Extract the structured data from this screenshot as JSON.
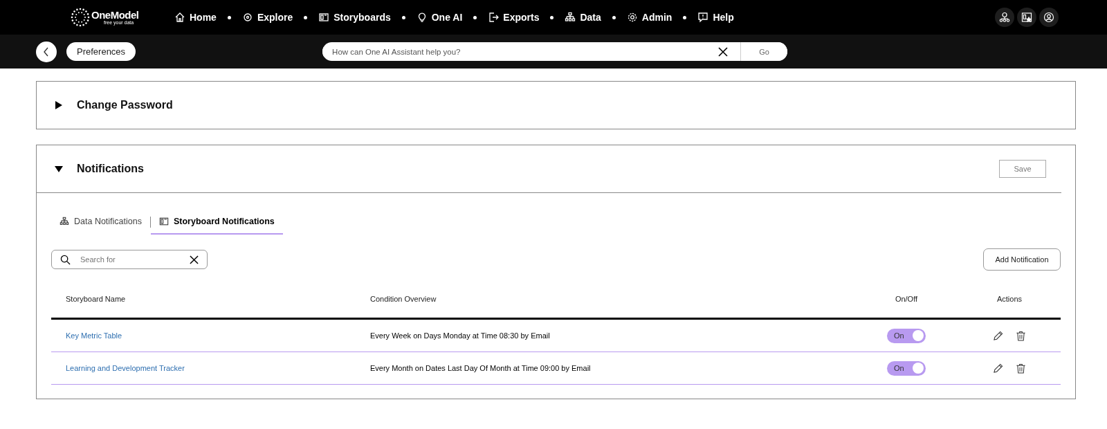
{
  "logo": {
    "name": "OneModel",
    "tagline": "free your data"
  },
  "nav": [
    {
      "label": "Home"
    },
    {
      "label": "Explore"
    },
    {
      "label": "Storyboards"
    },
    {
      "label": "One AI"
    },
    {
      "label": "Exports"
    },
    {
      "label": "Data"
    },
    {
      "label": "Admin"
    },
    {
      "label": "Help"
    }
  ],
  "breadcrumb": "Preferences",
  "assistant": {
    "placeholder": "How can One AI Assistant help you?",
    "button": "Go"
  },
  "sections": [
    {
      "title": "Change Password",
      "expanded": false
    },
    {
      "title": "Notifications",
      "expanded": true,
      "save": "Save"
    }
  ],
  "tabs": [
    {
      "label": "Data Notifications",
      "selected": false
    },
    {
      "label": "Storyboard Notifications",
      "selected": true
    }
  ],
  "search": {
    "placeholder": "Search for"
  },
  "add_button": "Add Notification",
  "table": {
    "columns": [
      "Storyboard Name",
      "Condition Overview",
      "On/Off",
      "Actions"
    ],
    "rows": [
      {
        "name": "Key Metric Table",
        "condition": "Every Week on Days Monday at Time 08:30 by Email",
        "on": true,
        "toggle_label": "On"
      },
      {
        "name": "Learning and Development Tracker",
        "condition": "Every Month on Dates Last Day Of Month at Time 09:00 by Email",
        "on": true,
        "toggle_label": "On"
      }
    ]
  }
}
